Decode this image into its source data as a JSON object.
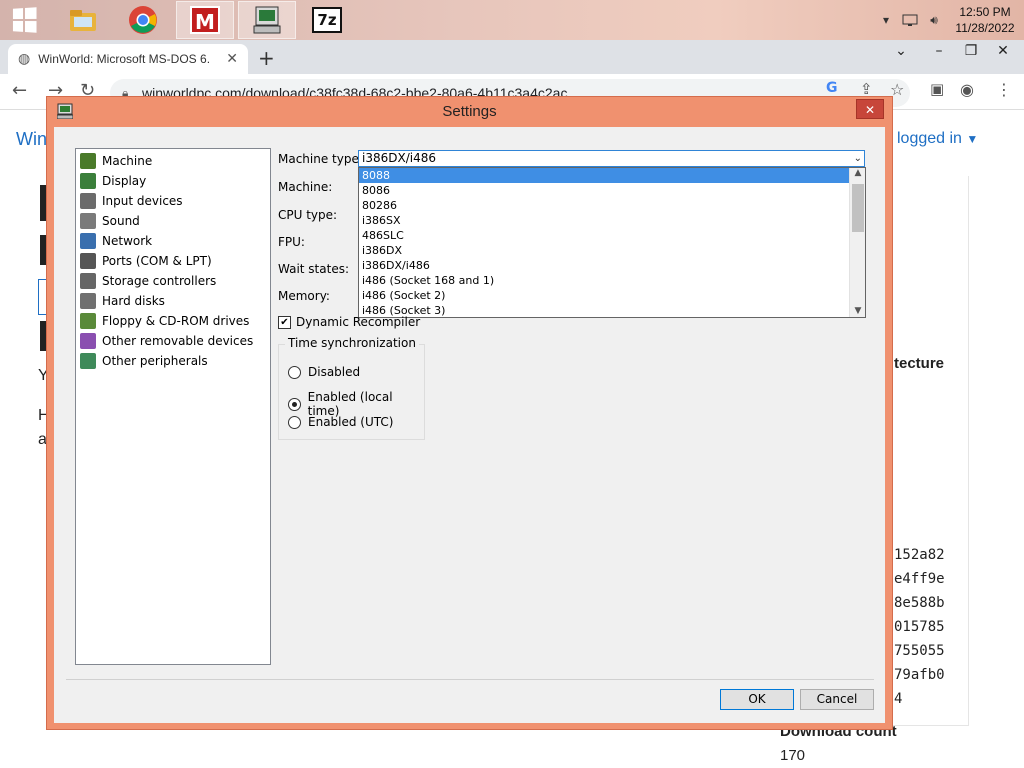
{
  "taskbar": {
    "apps": [
      {
        "name": "file-explorer",
        "color": "#e8b33c"
      },
      {
        "name": "chrome",
        "color": "#db4437"
      },
      {
        "name": "malwarebytes",
        "label": "M"
      },
      {
        "name": "86box",
        "label": ""
      },
      {
        "name": "7zip",
        "label": "7z"
      }
    ],
    "clock_time": "12:50 PM",
    "clock_date": "11/28/2022"
  },
  "browser": {
    "tab_title": "WinWorld: Microsoft MS-DOS 6.",
    "url": "winworldpc.com/download/c38fc38d-68c2-bbe2-80a6-4b11c3a4c2ac",
    "page_link_left": "Win",
    "page_link_right": "logged in",
    "bg_fragments": [
      "Y",
      "H",
      "a"
    ],
    "architecture": "tecture",
    "hashes": [
      "152a82",
      "e4ff9e",
      "8e588b",
      "015785",
      "755055",
      "79afb0",
      "4"
    ],
    "download_count_label": "Download count",
    "download_count": "170"
  },
  "dialog": {
    "title": "Settings",
    "categories": [
      {
        "label": "Machine",
        "color": "#4a7a2a"
      },
      {
        "label": "Display",
        "color": "#3b7f3b"
      },
      {
        "label": "Input devices",
        "color": "#6b6b6b"
      },
      {
        "label": "Sound",
        "color": "#7a7a7a"
      },
      {
        "label": "Network",
        "color": "#3a6fae"
      },
      {
        "label": "Ports (COM & LPT)",
        "color": "#555555"
      },
      {
        "label": "Storage controllers",
        "color": "#666666"
      },
      {
        "label": "Hard disks",
        "color": "#707070"
      },
      {
        "label": "Floppy & CD-ROM drives",
        "color": "#5a8a3a"
      },
      {
        "label": "Other removable devices",
        "color": "#8a4fb0"
      },
      {
        "label": "Other peripherals",
        "color": "#3f8a5a"
      }
    ],
    "labels": {
      "machine_type": "Machine type:",
      "machine": "Machine:",
      "cpu_type": "CPU type:",
      "fpu": "FPU:",
      "wait_states": "Wait states:",
      "memory": "Memory:"
    },
    "machine_type_value": "i386DX/i486",
    "machine_type_options": [
      "8088",
      "8086",
      "80286",
      "i386SX",
      "486SLC",
      "i386DX",
      "i386DX/i486",
      "i486 (Socket 168 and 1)",
      "i486 (Socket 2)",
      "i486 (Socket 3)"
    ],
    "dynamic_recompiler": {
      "label": "Dynamic Recompiler",
      "checked": true
    },
    "time_sync": {
      "title": "Time synchronization",
      "options": [
        "Disabled",
        "Enabled (local time)",
        "Enabled (UTC)"
      ],
      "selected": "Enabled (local time)"
    },
    "ok": "OK",
    "cancel": "Cancel"
  }
}
